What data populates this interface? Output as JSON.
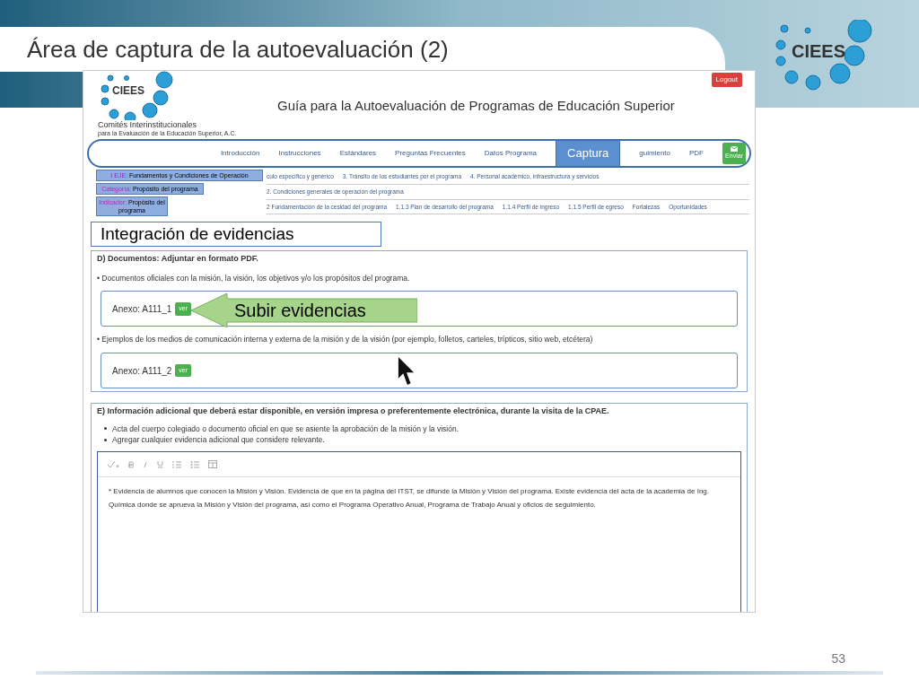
{
  "slide": {
    "title": "Área de captura de la autoevaluación (2)",
    "number": "53",
    "logo": "CIEES"
  },
  "site": {
    "logo": "CIEES",
    "org_name": "Comités Interinstitucionales",
    "org_sub": "para la Evaluación de la Educación Superior, A.C.",
    "title": "Guía para la Autoevaluación de Programas de Educación Superior",
    "logout": "Logout"
  },
  "nav": {
    "items": [
      {
        "label": "Introducción",
        "selected": false
      },
      {
        "label": "Instrucciones",
        "selected": false
      },
      {
        "label": "Estándares",
        "selected": false
      },
      {
        "label": "Preguntas Frecuentes",
        "selected": false
      },
      {
        "label": "Datos Programa",
        "selected": false
      },
      {
        "label": "Captura",
        "selected": true
      },
      {
        "label": "guimiento",
        "selected": false
      },
      {
        "label": "PDF",
        "selected": false
      }
    ],
    "send": "Enviar"
  },
  "labels": [
    {
      "kind": "eje",
      "key": "I EJE:",
      "value": "Fundamentos y Condiciones de Operación"
    },
    {
      "kind": "categoria",
      "key": "Categoría:",
      "value": "Propósito del programa"
    },
    {
      "kind": "indicador",
      "key": "Indicador:",
      "value": "Propósito del programa"
    }
  ],
  "subnav": [
    [
      "culo específico y genérico",
      "3. Tránsito de los estudiantes por el programa",
      "4. Personal académico, infraestructura y servicios"
    ],
    [
      "2. Condiciones generales de operación del programa"
    ],
    [
      "2 Fundamentación de la cesidad del programa",
      "1.1.3 Plan de desarrollo del programa",
      "1.1.4 Perfil de ingreso",
      "1.1.5 Perfil de egreso",
      "Fortalezas",
      "Oportunidades"
    ]
  ],
  "section_title": "Integración de evidencias",
  "documents": {
    "heading": "D) Documentos: Adjuntar en formato PDF.",
    "groups": [
      {
        "description": "• Documentos oficiales con la misión, la visión, los objetivos y/o los propósitos del programa.",
        "annex": "Anexo: A111_1",
        "button": "ver"
      },
      {
        "description": "• Ejemplos de los medios de comunicación interna y externa de la misión y de la visión (por ejemplo, folletos, carteles, trípticos, sitio web, etcétera)",
        "annex": "Anexo: A111_2",
        "button": "ver"
      }
    ]
  },
  "callout": "Subir evidencias",
  "additional": {
    "heading": "E) Información adicional que deberá estar disponible, en versión impresa o preferentemente electrónica, durante la visita de la CPAE.",
    "bullets": [
      "Acta del cuerpo colegiado o documento oficial en que se asiente la aprobación de la misión y la visión.",
      "Agregar cualquier evidencia adicional que considere relevante."
    ],
    "editor_text": "* Evidencia de alumnos que conocen la Misión y Visión. Evidencia de que en la página del ITST, se difunde la Misión y Visión del programa. Existe evidencia del acta de la academia de Ing. Química donde se aprueva la Misión y Visión del programa, así como el Programa Operativo Anual, Programa de Trabajo Anual y oficios de seguimiento."
  }
}
